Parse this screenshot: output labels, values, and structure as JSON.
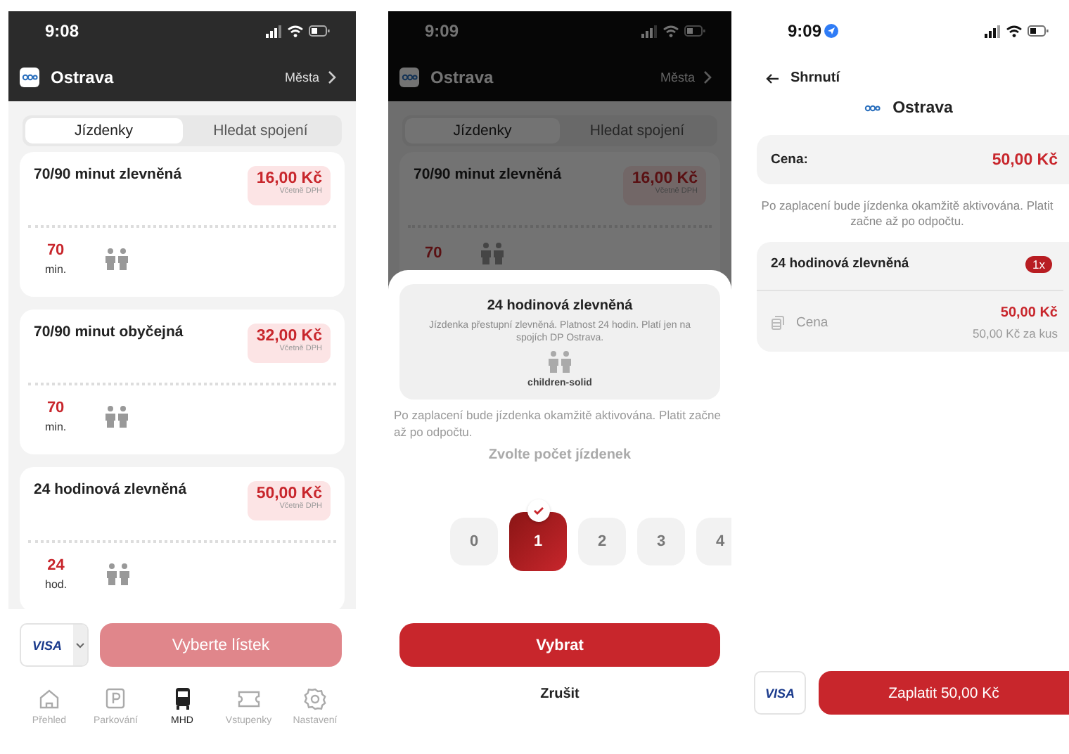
{
  "list_screen": {
    "status_time": "9:08",
    "city": "Ostrava",
    "cities_link": "Města",
    "tabs": [
      {
        "label": "Jízdenky",
        "selected": true
      },
      {
        "label": "Hledat spojení",
        "selected": false
      }
    ],
    "tickets": [
      {
        "name": "70/90 minut zlevněná",
        "price": "16,00 Kč",
        "price_note": "Včetně DPH",
        "duration": "70",
        "unit": "min."
      },
      {
        "name": "70/90 minut obyčejná",
        "price": "32,00 Kč",
        "price_note": "Včetně DPH",
        "duration": "70",
        "unit": "min."
      },
      {
        "name": "24 hodinová zlevněná",
        "price": "50,00 Kč",
        "price_note": "Včetně DPH",
        "duration": "24",
        "unit": "hod."
      }
    ],
    "card": "VISA",
    "select_button": {
      "label": "Vyberte lístek",
      "disabled": true
    },
    "nav": [
      {
        "label": "Přehled",
        "selected": false
      },
      {
        "label": "Parkování",
        "selected": false
      },
      {
        "label": "MHD",
        "selected": true
      },
      {
        "label": "Vstupenky",
        "selected": false
      },
      {
        "label": "Nastavení",
        "selected": false
      }
    ]
  },
  "count_screen": {
    "status_time": "9:09",
    "city": "Ostrava",
    "cities_link": "Města",
    "tabs": [
      {
        "label": "Jízdenky",
        "selected": true
      },
      {
        "label": "Hledat spojení",
        "selected": false
      }
    ],
    "ticket": {
      "name": "70/90 minut zlevněná",
      "price": "16,00 Kč",
      "price_note": "Včetně DPH",
      "duration": "70"
    },
    "sheet": {
      "title": "24 hodinová zlevněná",
      "description": "Jízdenka přestupní zlevněná. Platnost 24 hodin. Platí jen na spojích DP Ostrava.",
      "icon_caption": "children-solid",
      "notice": "Po zaplacení bude jízdenka okamžitě aktivována. Platit začne až po odpočtu.",
      "prompt": "Zvolte počet jízdenek",
      "counts": [
        {
          "label": "0",
          "selected": false
        },
        {
          "label": "1",
          "selected": true
        },
        {
          "label": "2",
          "selected": false
        },
        {
          "label": "3",
          "selected": false
        },
        {
          "label": "4",
          "selected": false
        }
      ],
      "confirm": "Vybrat",
      "cancel": "Zrušit"
    }
  },
  "summary_screen": {
    "status_time": "9:09",
    "back_title": "Shrnutí",
    "city": "Ostrava",
    "price_label": "Cena:",
    "price": "50,00 Kč",
    "notice": "Po zaplacení bude jízdenka okamžitě aktivována. Platit začne až po odpočtu.",
    "item": {
      "name": "24 hodinová zlevněná",
      "quantity": "1x",
      "price_label": "Cena",
      "price": "50,00 Kč",
      "unit_price": "50,00 Kč za kus"
    },
    "card": "VISA",
    "pay_button": "Zaplatit 50,00 Kč"
  }
}
